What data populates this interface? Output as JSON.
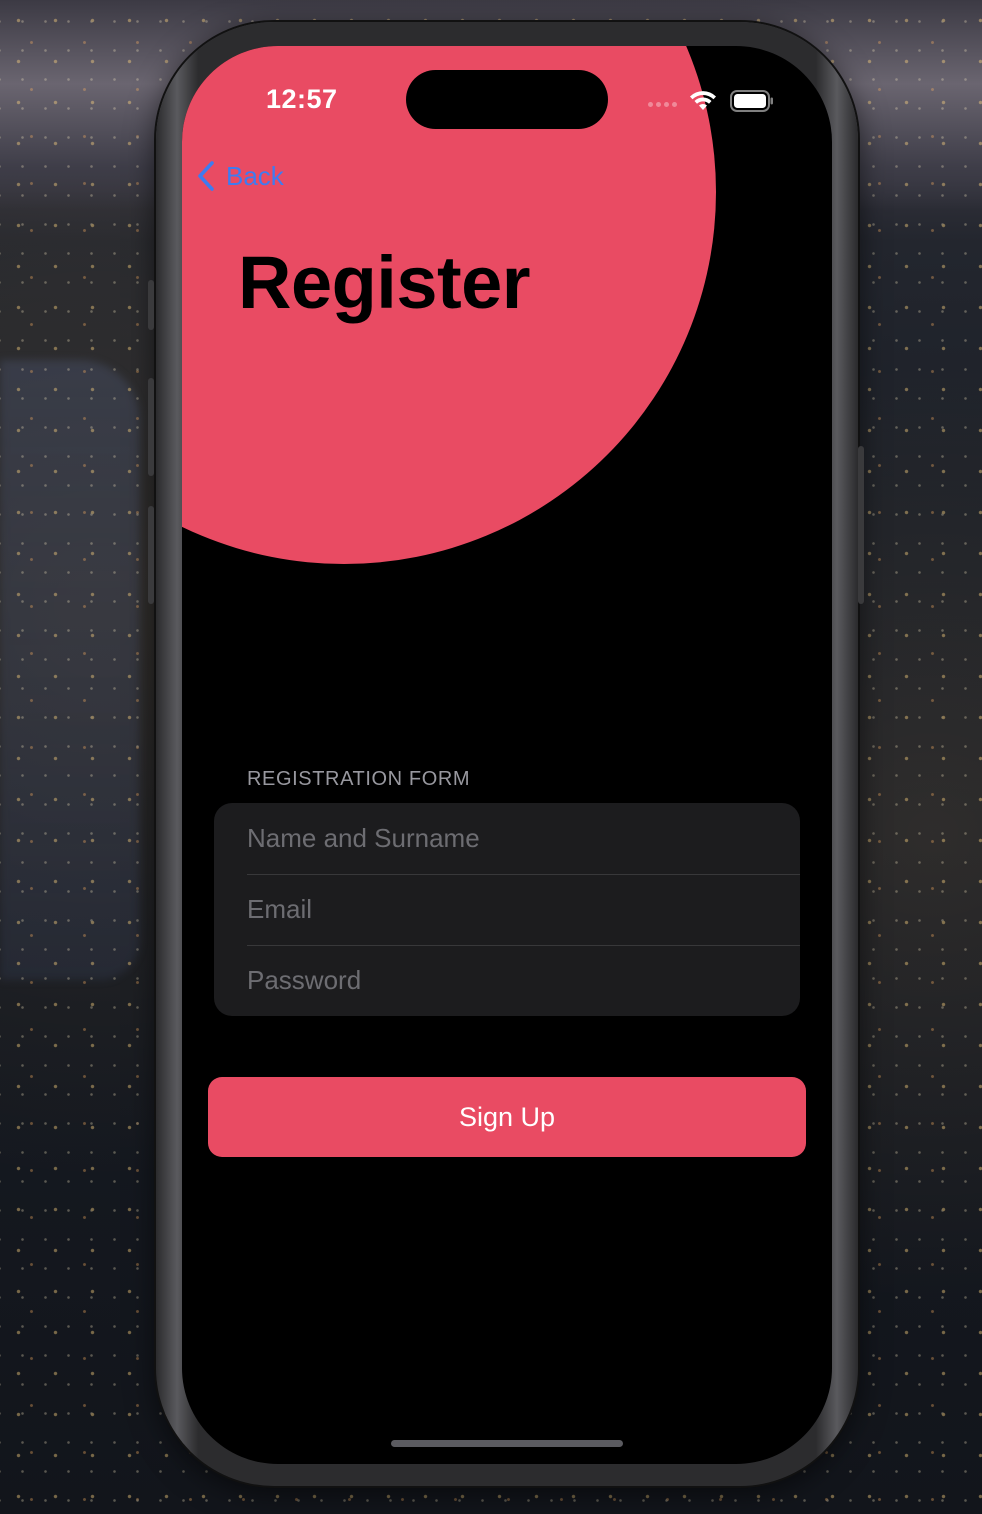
{
  "status_bar": {
    "time": "12:57"
  },
  "nav": {
    "back_label": "Back",
    "back_icon": "chevron-left-icon"
  },
  "header": {
    "title": "Register"
  },
  "form": {
    "section_label": "REGISTRATION FORM",
    "fields": [
      {
        "name": "name",
        "value": "",
        "placeholder": "Name and Surname"
      },
      {
        "name": "email",
        "value": "",
        "placeholder": "Email"
      },
      {
        "name": "password",
        "value": "",
        "placeholder": "Password"
      }
    ]
  },
  "actions": {
    "sign_up_label": "Sign Up"
  },
  "colors": {
    "accent": "#e94b63",
    "link": "#3f7bf0",
    "background": "#000000",
    "field_background": "#1c1c1e"
  }
}
